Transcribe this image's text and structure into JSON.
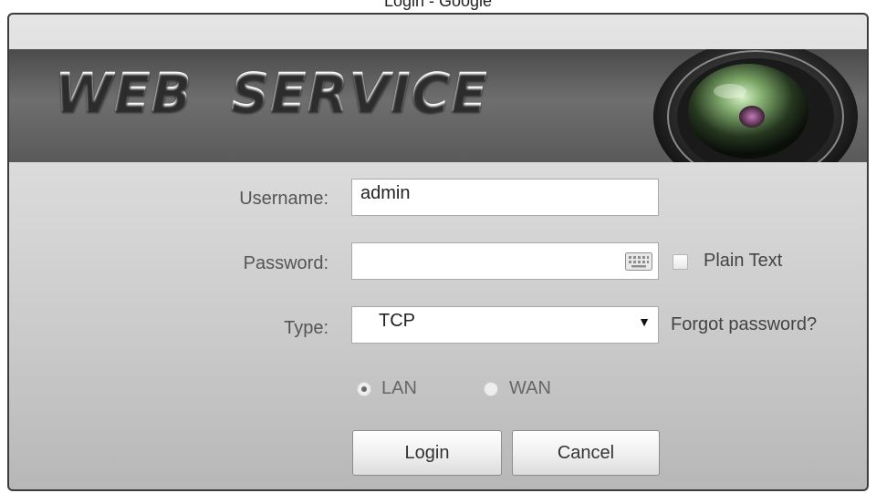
{
  "window": {
    "title": "Login - Google"
  },
  "banner": {
    "title": "WEB  SERVICE"
  },
  "form": {
    "username_label": "Username:",
    "username_value": "admin",
    "password_label": "Password:",
    "password_value": "",
    "plain_text_label": "Plain Text",
    "type_label": "Type:",
    "type_value": "TCP",
    "type_arrow": "▼",
    "forgot_link": "Forgot password?",
    "network": {
      "lan_label": "LAN",
      "wan_label": "WAN",
      "selected": "LAN"
    },
    "login_label": "Login",
    "cancel_label": "Cancel"
  },
  "colors": {
    "banner": "#5f5f5f",
    "panel": "#d4d4d4",
    "frame_border": "#3c3c3c"
  },
  "icons": {
    "keyboard": "keyboard-icon",
    "lens": "camera-lens-icon",
    "dropdown": "chevron-down-icon"
  }
}
